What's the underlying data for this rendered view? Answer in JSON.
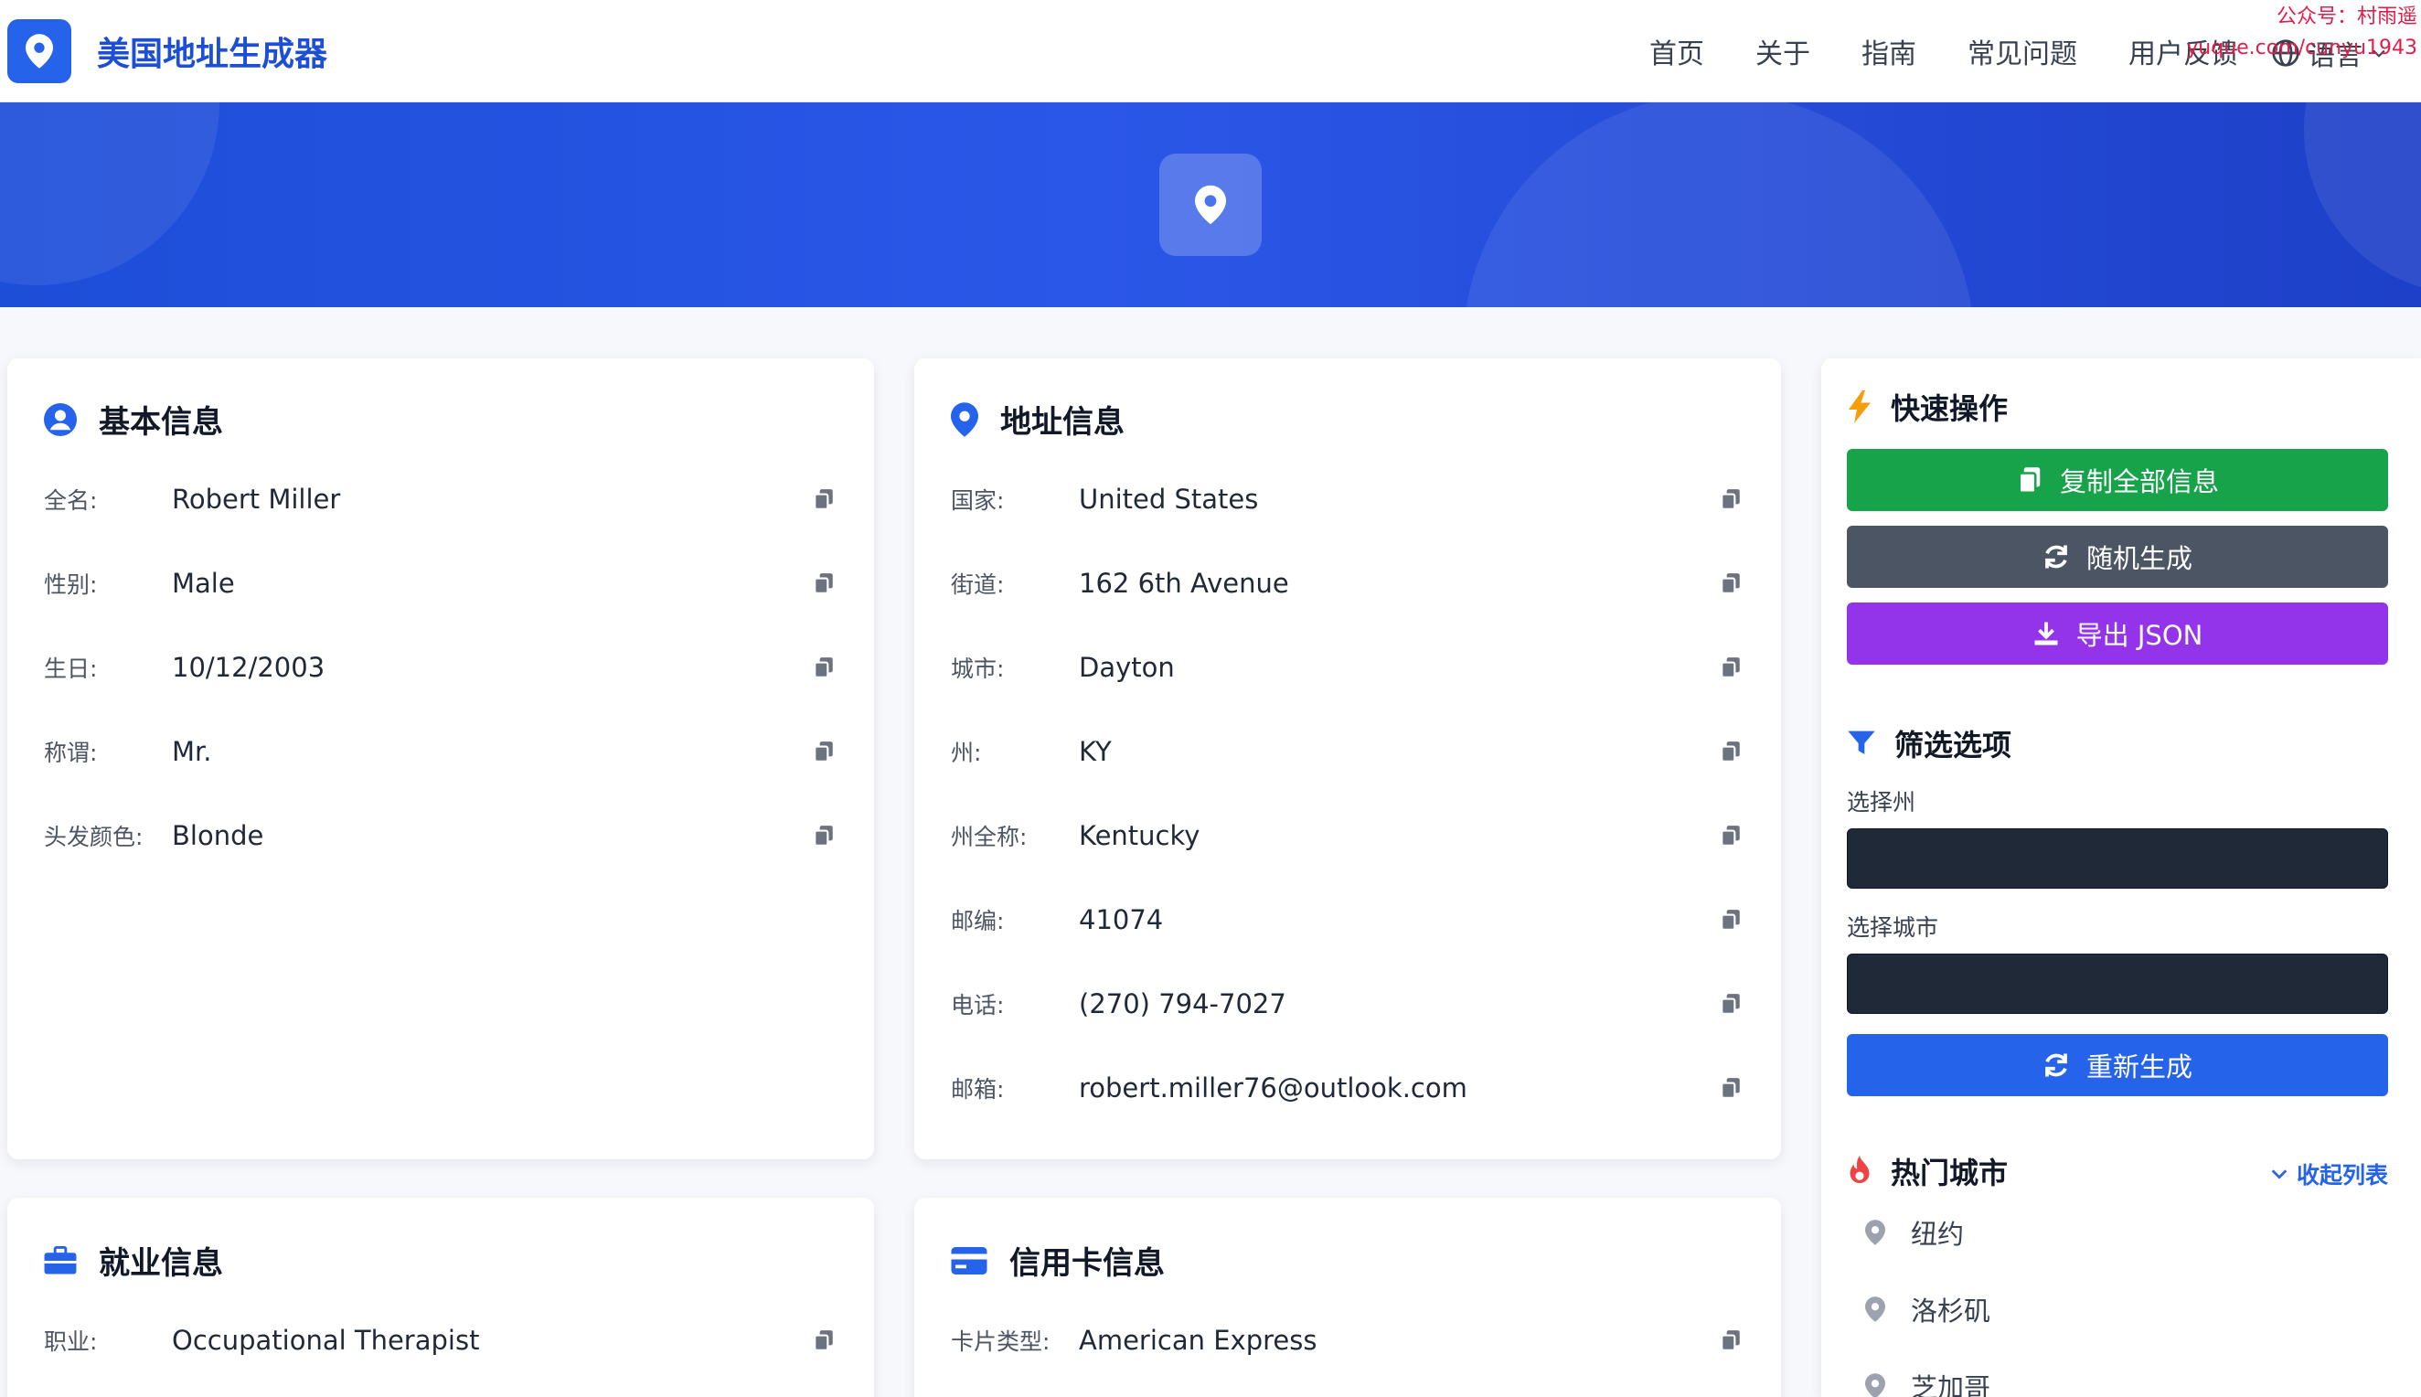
{
  "app": {
    "brand": "美国地址生成器",
    "nav": [
      "首页",
      "关于",
      "指南",
      "常见问题",
      "用户反馈"
    ],
    "language_label": "语言",
    "watermark_line1": "公众号：村雨遥",
    "watermark_line2": "yuque.com/cunyu1943"
  },
  "basic": {
    "title": "基本信息",
    "rows": [
      {
        "label": "全名:",
        "value": "Robert Miller"
      },
      {
        "label": "性别:",
        "value": "Male"
      },
      {
        "label": "生日:",
        "value": "10/12/2003"
      },
      {
        "label": "称谓:",
        "value": "Mr."
      },
      {
        "label": "头发颜色:",
        "value": "Blonde"
      }
    ]
  },
  "address": {
    "title": "地址信息",
    "rows": [
      {
        "label": "国家:",
        "value": "United States"
      },
      {
        "label": "街道:",
        "value": "162 6th Avenue"
      },
      {
        "label": "城市:",
        "value": "Dayton"
      },
      {
        "label": "州:",
        "value": "KY"
      },
      {
        "label": "州全称:",
        "value": "Kentucky"
      },
      {
        "label": "邮编:",
        "value": "41074"
      },
      {
        "label": "电话:",
        "value": "(270) 794-7027"
      },
      {
        "label": "邮箱:",
        "value": "robert.miller76@outlook.com"
      }
    ]
  },
  "employment": {
    "title": "就业信息",
    "rows": [
      {
        "label": "职业:",
        "value": "Occupational Therapist"
      }
    ]
  },
  "credit": {
    "title": "信用卡信息",
    "rows": [
      {
        "label": "卡片类型:",
        "value": "American Express"
      }
    ]
  },
  "quick": {
    "title": "快速操作",
    "copy_all": "复制全部信息",
    "random": "随机生成",
    "export": "导出 JSON"
  },
  "filter": {
    "title": "筛选选项",
    "state_label": "选择州",
    "city_label": "选择城市",
    "regenerate": "重新生成"
  },
  "hot": {
    "title": "热门城市",
    "collapse": "收起列表",
    "cities": [
      "纽约",
      "洛杉矶",
      "芝加哥"
    ]
  },
  "colors": {
    "primary": "#2563eb",
    "green": "#16a34a",
    "gray": "#4b5563",
    "purple": "#9333ea",
    "select_bg": "#1f2937"
  }
}
